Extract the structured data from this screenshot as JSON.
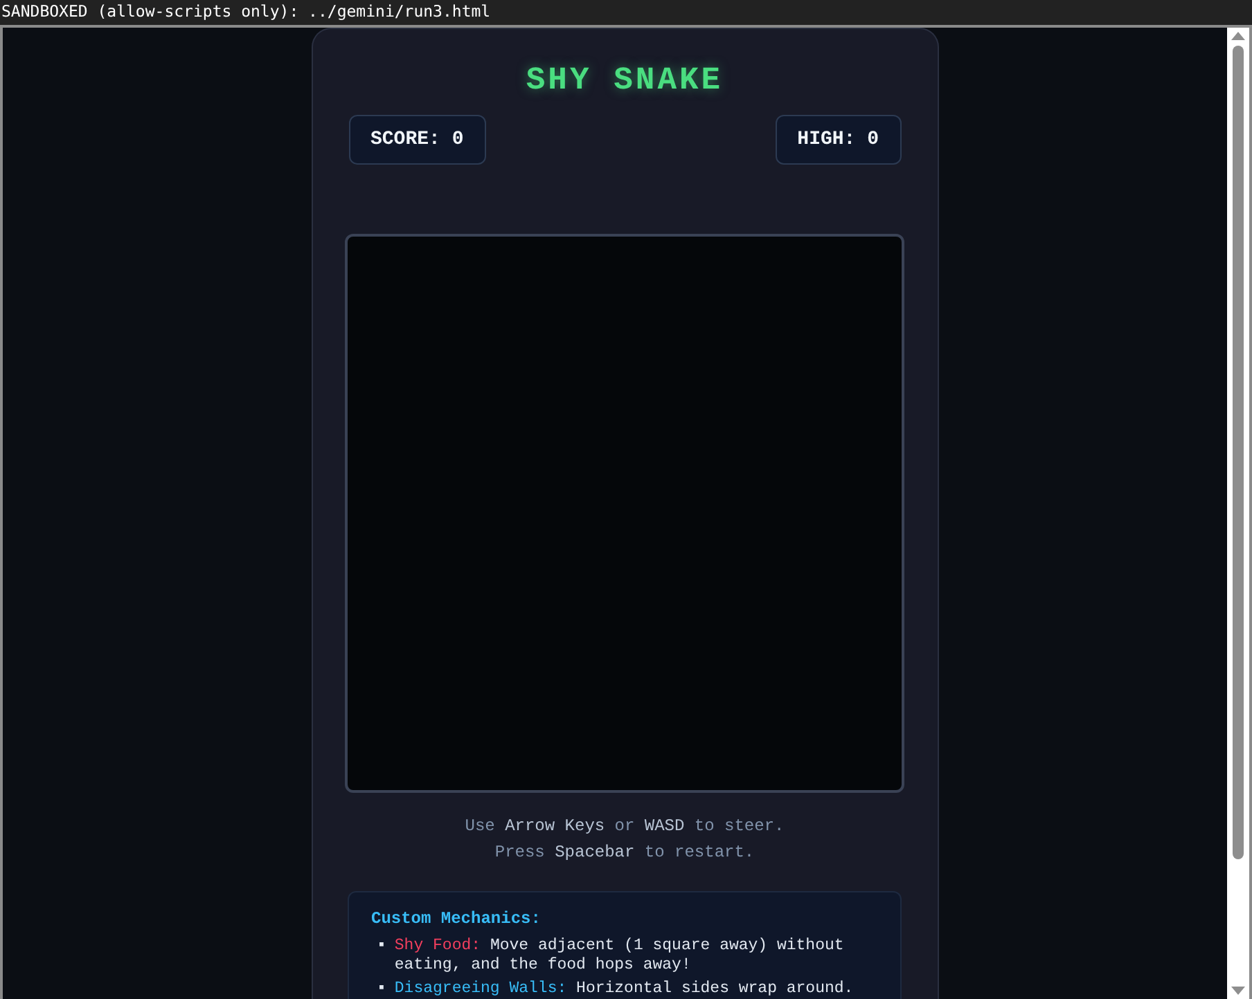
{
  "top_bar": {
    "text": "SANDBOXED (allow-scripts only): ../gemini/run3.html"
  },
  "title": "SHY SNAKE",
  "score": {
    "label": "SCORE:",
    "value": "0"
  },
  "high": {
    "label": "HIGH:",
    "value": "0"
  },
  "instructions": [
    "Use **Arrow Keys** or **WASD** to steer.",
    "Press **Spacebar** to restart."
  ],
  "mechanics": {
    "heading": "Custom Mechanics:",
    "items": [
      {
        "marker": "▪",
        "label": "Shy Food:",
        "color": "#f43f5e",
        "text": "Move adjacent (1 square away) without eating, and the food hops away!"
      },
      {
        "marker": "▪",
        "label": "Disagreeing Walls:",
        "color": "#38bdf8",
        "text": "Horizontal sides wrap around."
      }
    ]
  }
}
